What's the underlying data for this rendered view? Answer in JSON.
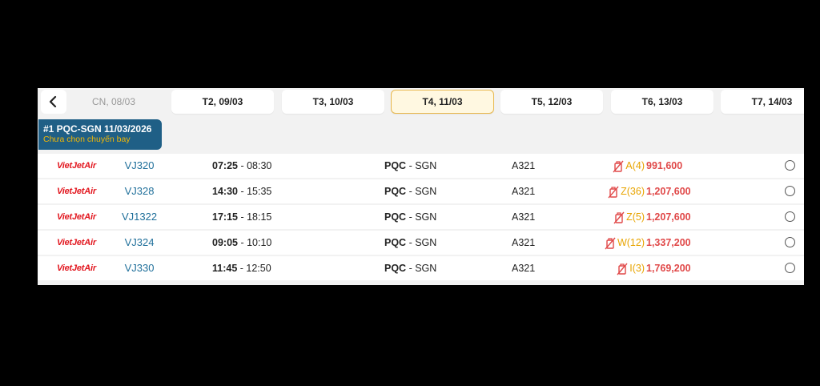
{
  "date_tabs": [
    {
      "label": "CN, 08/03"
    },
    {
      "label": "T2, 09/03"
    },
    {
      "label": "T3, 10/03"
    },
    {
      "label": "T4, 11/03"
    },
    {
      "label": "T5, 12/03"
    },
    {
      "label": "T6, 13/03"
    },
    {
      "label": "T7, 14/03"
    }
  ],
  "leg": {
    "title": "#1 PQC-SGN 11/03/2026",
    "subtitle": "Chưa chọn chuyến bay"
  },
  "flights": [
    {
      "airline": "VietJetAir",
      "flight_no": "VJ320",
      "depart": "07:25",
      "sep": " - ",
      "arrive": "08:30",
      "from": "PQC",
      "route_sep": " - ",
      "to": "SGN",
      "aircraft": "A321",
      "fare_class": "A(4)",
      "price": "991,600"
    },
    {
      "airline": "VietJetAir",
      "flight_no": "VJ328",
      "depart": "14:30",
      "sep": " - ",
      "arrive": "15:35",
      "from": "PQC",
      "route_sep": " - ",
      "to": "SGN",
      "aircraft": "A321",
      "fare_class": "Z(36)",
      "price": "1,207,600"
    },
    {
      "airline": "VietJetAir",
      "flight_no": "VJ1322",
      "depart": "17:15",
      "sep": " - ",
      "arrive": "18:15",
      "from": "PQC",
      "route_sep": " - ",
      "to": "SGN",
      "aircraft": "A321",
      "fare_class": "Z(5)",
      "price": "1,207,600"
    },
    {
      "airline": "VietJetAir",
      "flight_no": "VJ324",
      "depart": "09:05",
      "sep": " - ",
      "arrive": "10:10",
      "from": "PQC",
      "route_sep": " - ",
      "to": "SGN",
      "aircraft": "A321",
      "fare_class": "W(12)",
      "price": "1,337,200"
    },
    {
      "airline": "VietJetAir",
      "flight_no": "VJ330",
      "depart": "11:45",
      "sep": " - ",
      "arrive": "12:50",
      "from": "PQC",
      "route_sep": " - ",
      "to": "SGN",
      "aircraft": "A321",
      "fare_class": "I(3)",
      "price": "1,769,200"
    }
  ],
  "colors": {
    "leg_bg": "#1f5f86",
    "subtitle": "#f2b705",
    "flight_no": "#1f6f9a",
    "price": "#e04848",
    "fare_class": "#e8a400",
    "airline_logo": "#e2171f",
    "active_tab_bg": "#fff8e1",
    "active_tab_border": "#e8b84d"
  },
  "icons": {
    "back": "chevron-left-icon",
    "baggage": "no-checked-baggage-icon",
    "select": "radio-button-icon"
  }
}
